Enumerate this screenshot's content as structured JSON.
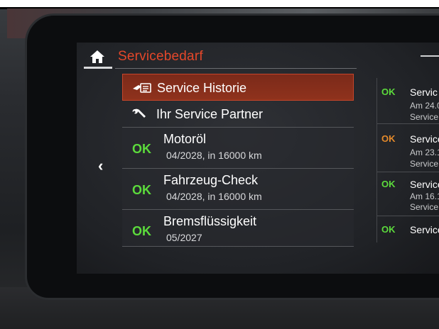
{
  "header": {
    "title": "Servicebedarf",
    "home_icon": "home-icon",
    "back_icon": "chevron-left-icon"
  },
  "menu": [
    {
      "label": "Service Historie",
      "icon": "service-history-icon",
      "selected": true
    },
    {
      "label": "Ihr Service Partner",
      "icon": "wrench-icon",
      "selected": false
    }
  ],
  "services": [
    {
      "status": "OK",
      "name": "Motoröl",
      "detail": "04/2028, in 16000 km"
    },
    {
      "status": "OK",
      "name": "Fahrzeug-Check",
      "detail": "04/2028, in 16000 km"
    },
    {
      "status": "OK",
      "name": "Bremsflüssigkeit",
      "detail": "05/2027"
    }
  ],
  "history_preview": [
    {
      "status": "OK",
      "title": "Servic",
      "line1": "Am 24.0",
      "line2": "Service"
    },
    {
      "status": "OK",
      "title": "Service",
      "line1": "Am 23.1",
      "line2": "Service"
    },
    {
      "status": "OK",
      "title": "Service",
      "line1": "Am 16.1",
      "line2": "Service F"
    },
    {
      "status": "OK",
      "title": "Service:",
      "line1": "",
      "line2": ""
    }
  ],
  "colors": {
    "accent": "#e4472a",
    "ok_green": "#5cdb3c",
    "ok_orange": "#e58a2a"
  }
}
